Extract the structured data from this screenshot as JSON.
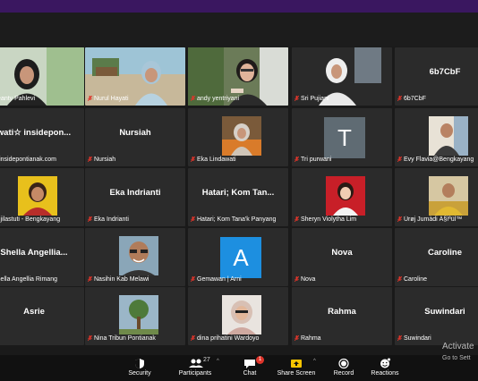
{
  "tiles": [
    {
      "label": "Heanty Pahlevi",
      "big": "",
      "type": "photo-woman-hijab"
    },
    {
      "label": "Nurul Hayati",
      "big": "",
      "type": "photo-beach"
    },
    {
      "label": "andy yentriyani",
      "big": "",
      "type": "photo-active"
    },
    {
      "label": "Sri Pujiani",
      "big": "",
      "type": "photo-hijab-white"
    },
    {
      "label": "6b7CbF",
      "big": "6b7CbF",
      "type": "name"
    },
    {
      "label": "@insidepontianak.com",
      "big": "wati☆ insidepon...",
      "type": "name"
    },
    {
      "label": "Nursiah",
      "big": "Nursiah",
      "type": "name"
    },
    {
      "label": "Eka Lindawati",
      "big": "",
      "type": "avatar-hijab"
    },
    {
      "label": "Tri purwani",
      "big": "",
      "type": "letter",
      "letter": "T",
      "color": "#5f6b73"
    },
    {
      "label": "Evy Flavia@Bengkayang",
      "big": "",
      "type": "avatar-man"
    },
    {
      "label": "Pujilastuti - Bengkayang",
      "big": "",
      "type": "avatar-woman-yellow"
    },
    {
      "label": "Eka Indrianti",
      "big": "Eka Indrianti",
      "type": "name"
    },
    {
      "label": "Hatari; Kom Tana'k Panyang",
      "big": "Hatari; Kom Tan...",
      "type": "name"
    },
    {
      "label": "Sheryn Violytha Lim",
      "big": "",
      "type": "avatar-girl-red"
    },
    {
      "label": "Úrøj Jumàdi Á§ìªül™",
      "big": "",
      "type": "avatar-man-yellow"
    },
    {
      "label": "Shella Angellia Rimang",
      "big": "Shella Angellia...",
      "type": "name"
    },
    {
      "label": "Nasihin Kab Melawi",
      "big": "",
      "type": "avatar-glasses"
    },
    {
      "label": "Gemawan | Arni",
      "big": "",
      "type": "letter",
      "letter": "A",
      "color": "#1d8fe0"
    },
    {
      "label": "Nova",
      "big": "Nova",
      "type": "name"
    },
    {
      "label": "Caroline",
      "big": "Caroline",
      "type": "name"
    },
    {
      "label": "rie",
      "big": "Asrie",
      "type": "name"
    },
    {
      "label": "Nina Tribun Pontianak",
      "big": "",
      "type": "avatar-tree"
    },
    {
      "label": "dina prihatini Wardoyo",
      "big": "",
      "type": "avatar-hijab-pink"
    },
    {
      "label": "Rahma",
      "big": "Rahma",
      "type": "name"
    },
    {
      "label": "Suwindari",
      "big": "Suwindari",
      "type": "name"
    }
  ],
  "toolbar": {
    "security": "Security",
    "participants": "Participants",
    "participants_count": "27",
    "chat": "Chat",
    "chat_badge": "1",
    "share": "Share Screen",
    "record": "Record",
    "reactions": "Reactions"
  },
  "watermark": {
    "line1": "Activate",
    "line2": "Go to Sett"
  },
  "colors": {
    "active_border": "#b7e042",
    "mute_red": "#e0352b",
    "top_purple": "#3a1760"
  }
}
